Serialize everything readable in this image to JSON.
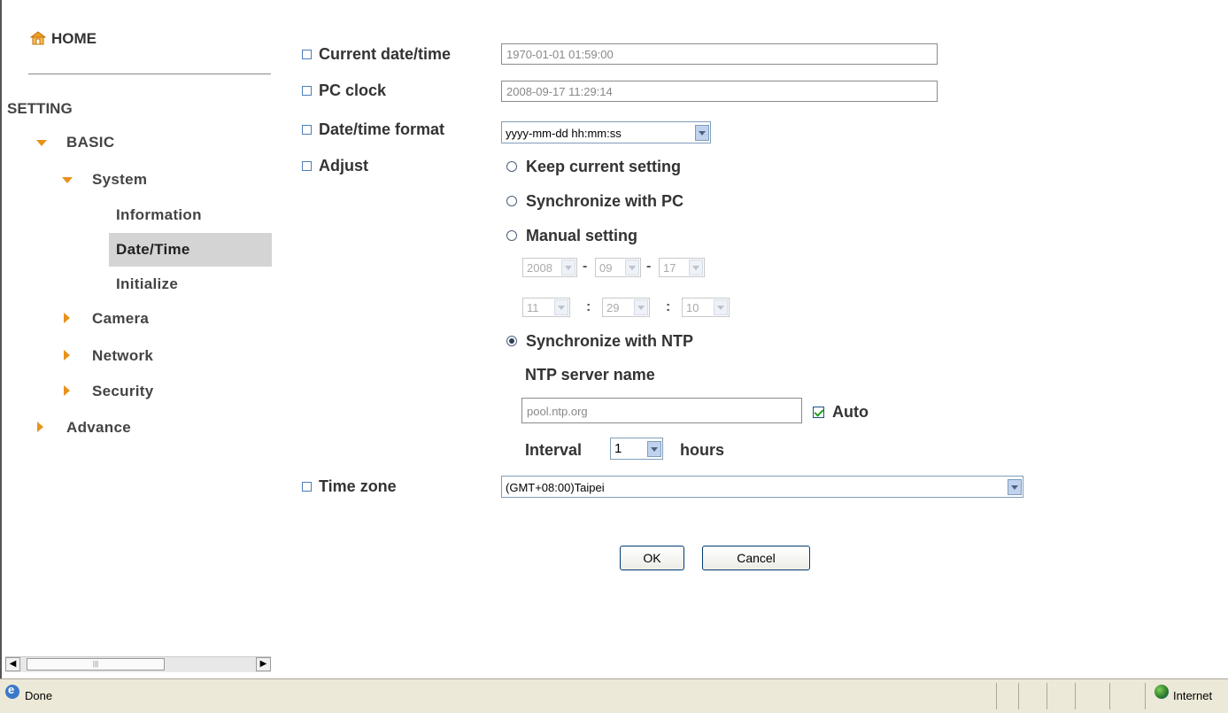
{
  "sidebar": {
    "home_label": "HOME",
    "setting_label": "SETTING",
    "basic_label": "BASIC",
    "system_label": "System",
    "system_items": [
      "Information",
      "Date/Time",
      "Initialize"
    ],
    "camera_label": "Camera",
    "network_label": "Network",
    "security_label": "Security",
    "advance_label": "Advance",
    "selected": "Date/Time"
  },
  "form": {
    "current_datetime_label": "Current date/time",
    "current_datetime_value": "1970-01-01   01:59:00",
    "pc_clock_label": "PC clock",
    "pc_clock_value": "2008-09-17   11:29:14",
    "format_label": "Date/time format",
    "format_value": "yyyy-mm-dd hh:mm:ss",
    "adjust_label": "Adjust",
    "options": {
      "keep": "Keep current setting",
      "sync_pc": "Synchronize with PC",
      "manual": "Manual setting",
      "sync_ntp": "Synchronize with NTP"
    },
    "selected_option": "sync_ntp",
    "manual": {
      "year": "2008",
      "month": "09",
      "day": "17",
      "hour": "11",
      "minute": "29",
      "second": "10",
      "date_sep": "-",
      "time_sep": ":"
    },
    "ntp_server_label": "NTP server name",
    "ntp_server_value": "pool.ntp.org",
    "auto_label": "Auto",
    "auto_checked": true,
    "interval_label": "Interval",
    "interval_value": "1",
    "interval_unit": "hours",
    "timezone_label": "Time zone",
    "timezone_value": "(GMT+08:00)Taipei",
    "ok_label": "OK",
    "cancel_label": "Cancel"
  },
  "statusbar": {
    "status_text": "Done",
    "zone_text": "Internet"
  },
  "colors": {
    "accent_triangle": "#e8921c",
    "selected_bg": "#d4d4d4",
    "statusbar_bg": "#ece9d8"
  }
}
